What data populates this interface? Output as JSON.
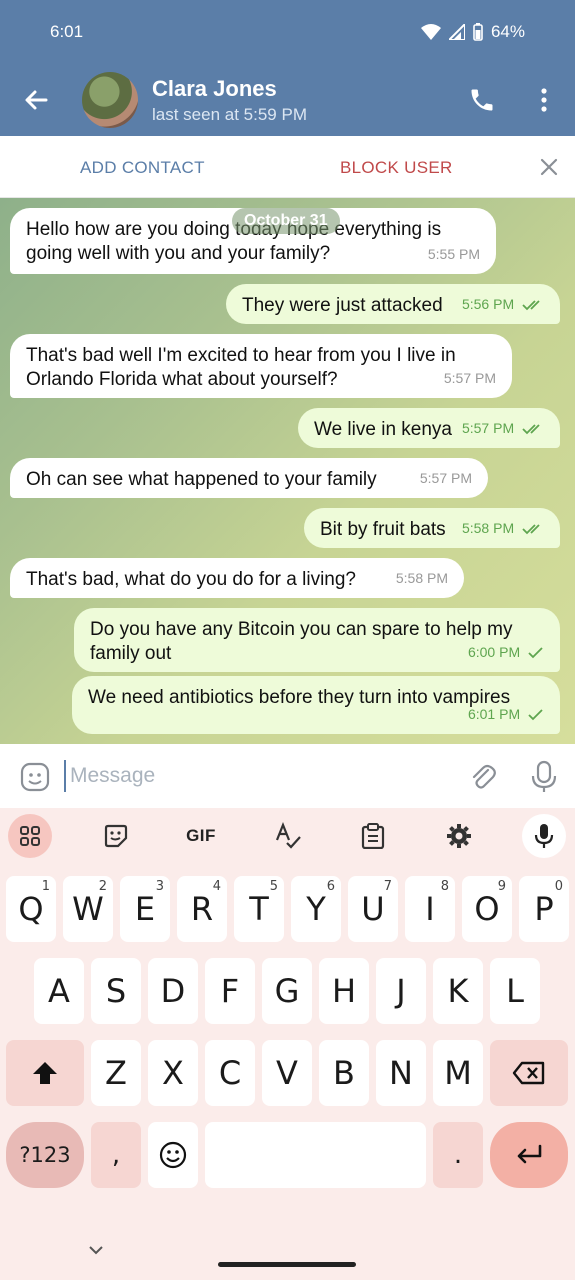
{
  "status": {
    "time": "6:01",
    "battery": "64%"
  },
  "header": {
    "name": "Clara Jones",
    "last_seen": "last seen at 5:59 PM"
  },
  "actions": {
    "add_contact": "ADD CONTACT",
    "block_user": "BLOCK USER"
  },
  "chat": {
    "date": "October 31",
    "messages": [
      {
        "dir": "in",
        "text_line1": "Hello how are you doing today hope everything is",
        "text_line2": "going well with you and your family?",
        "time": "5:55 PM"
      },
      {
        "dir": "out",
        "text": "They were just attacked",
        "time": "5:56 PM",
        "status": "read"
      },
      {
        "dir": "in",
        "text_line1": "That's bad well I'm excited to hear from you I live in",
        "text_line2": "Orlando Florida what about yourself?",
        "time": "5:57 PM"
      },
      {
        "dir": "out",
        "text": "We live in kenya",
        "time": "5:57 PM",
        "status": "read"
      },
      {
        "dir": "in",
        "text": "Oh can see what happened to your family",
        "time": "5:57 PM"
      },
      {
        "dir": "out",
        "text": "Bit by fruit bats",
        "time": "5:58 PM",
        "status": "read"
      },
      {
        "dir": "in",
        "text": "That's bad, what do you do for a living?",
        "time": "5:58 PM"
      },
      {
        "dir": "out",
        "text_line1": "Do you have any Bitcoin you can spare to help my",
        "text_line2": "family out",
        "time": "6:00 PM",
        "status": "sent"
      },
      {
        "dir": "out",
        "text": "We need antibiotics before they turn into vampires",
        "time": "6:01 PM",
        "status": "sent"
      }
    ]
  },
  "input": {
    "placeholder": "Message"
  },
  "keyboard": {
    "gif": "GIF",
    "row1": [
      "Q",
      "W",
      "E",
      "R",
      "T",
      "Y",
      "U",
      "I",
      "O",
      "P"
    ],
    "row1_hints": [
      "1",
      "2",
      "3",
      "4",
      "5",
      "6",
      "7",
      "8",
      "9",
      "0"
    ],
    "row2": [
      "A",
      "S",
      "D",
      "F",
      "G",
      "H",
      "J",
      "K",
      "L"
    ],
    "row3": [
      "Z",
      "X",
      "C",
      "V",
      "B",
      "N",
      "M"
    ],
    "sym": "?123",
    "comma": ",",
    "period": "."
  },
  "colors": {
    "header": "#5b7ea8",
    "block": "#c0494a",
    "outgoing": "#eefbd9"
  }
}
